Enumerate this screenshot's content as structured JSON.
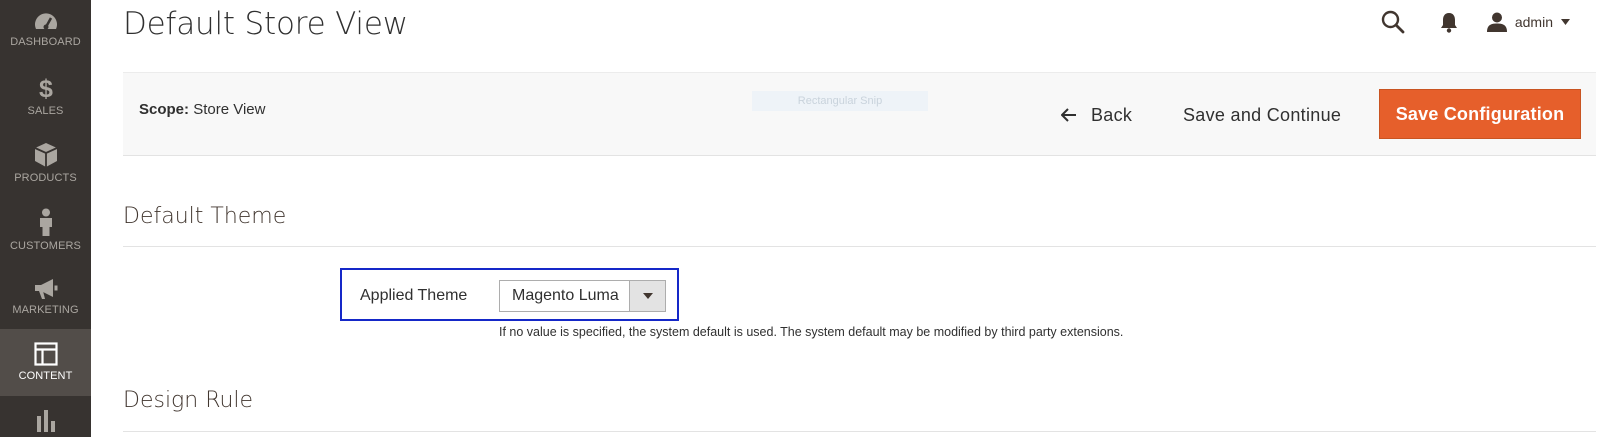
{
  "sidebar": {
    "items": [
      {
        "label": "DASHBOARD",
        "icon": "dashboard-icon"
      },
      {
        "label": "SALES",
        "icon": "dollar-icon"
      },
      {
        "label": "PRODUCTS",
        "icon": "box-icon"
      },
      {
        "label": "CUSTOMERS",
        "icon": "person-icon"
      },
      {
        "label": "MARKETING",
        "icon": "megaphone-icon"
      },
      {
        "label": "CONTENT",
        "icon": "layout-icon",
        "active": true
      },
      {
        "label": "",
        "icon": "bar-chart-icon"
      }
    ]
  },
  "header": {
    "title": "Default Store View",
    "user": "admin"
  },
  "actions": {
    "scope_label": "Scope:",
    "scope_value": "Store View",
    "ghost_text": "Rectangular Snip",
    "back": "Back",
    "save_continue": "Save and Continue",
    "save_config": "Save Configuration"
  },
  "sections": {
    "default_theme": {
      "title": "Default Theme",
      "field_label": "Applied Theme",
      "selected": "Magento Luma",
      "note": "If no value is specified, the system default is used. The system default may be modified by third party extensions."
    },
    "design_rule": {
      "title": "Design Rule"
    }
  },
  "colors": {
    "sidebar_bg": "#373330",
    "sidebar_active": "#524d49",
    "primary_button": "#e65f2b",
    "highlight_border": "#1528c8"
  }
}
